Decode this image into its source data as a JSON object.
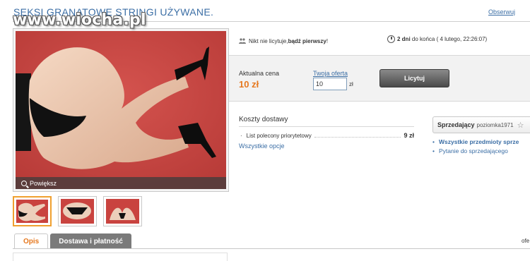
{
  "watermark": "www.wiocha.pl",
  "listing": {
    "title": "SEKSI GRANATOWE STRINGI UŻYWANE.",
    "observe_label": "Obserwuj"
  },
  "gallery": {
    "zoom_label": "Powiększ"
  },
  "auction": {
    "no_bids_text": "Nikt nie licytuje, ",
    "be_first_text": "bądź pierwszy",
    "be_first_suffix": "!",
    "time_left_bold": "2 dni",
    "time_left_rest": " do końca ( 4 lutego, 22:26:07)",
    "current_price_label": "Aktualna cena",
    "current_price_value": "10 zł",
    "your_offer_label": "Twoja oferta",
    "your_offer_value": "10",
    "currency": "zł",
    "bid_button": "Licytuj"
  },
  "shipping": {
    "title": "Koszty dostawy",
    "methods": [
      {
        "name": "List polecony priorytetowy",
        "price": "9 zł"
      }
    ],
    "all_options": "Wszystkie opcje"
  },
  "seller": {
    "label": "Sprzedający",
    "name": "poziomka1971",
    "links": [
      {
        "label": "Wszystkie przedmioty sprze",
        "bold": true
      },
      {
        "label": "Pytanie do sprzedającego",
        "bold": false
      }
    ]
  },
  "tabs": [
    {
      "label": "Opis",
      "active": true
    },
    {
      "label": "Dostawa i płatność",
      "active": false
    }
  ],
  "right_cut_text": "ofe",
  "colors": {
    "link": "#3b6ea5",
    "price": "#e6781e",
    "photo_background": "#c9433f"
  }
}
